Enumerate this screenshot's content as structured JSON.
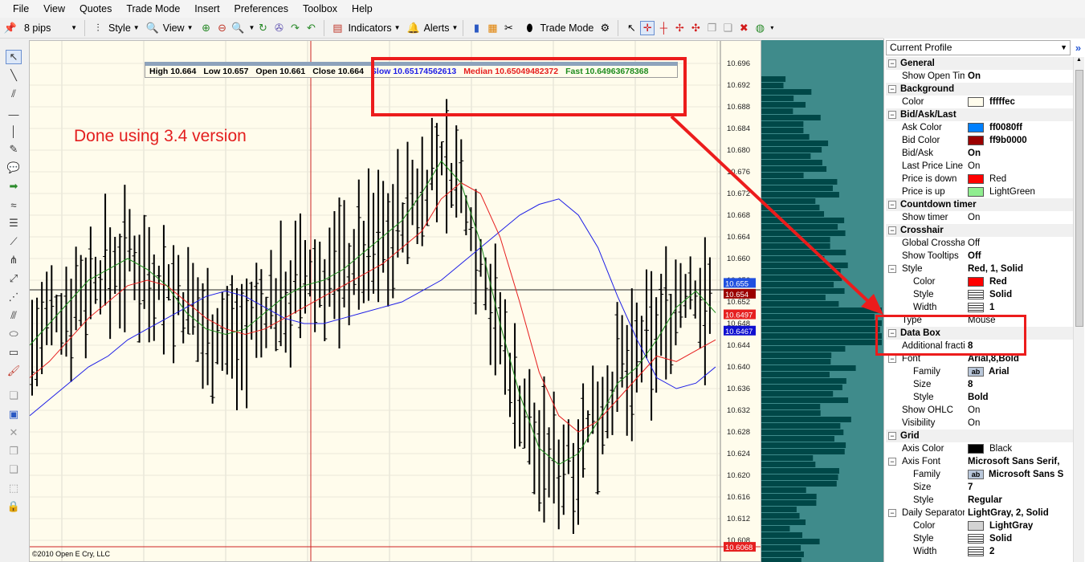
{
  "menu": [
    "File",
    "View",
    "Quotes",
    "Trade Mode",
    "Insert",
    "Preferences",
    "Toolbox",
    "Help"
  ],
  "toolbar": {
    "pips": "8 pips",
    "style_label": "Style",
    "view_label": "View",
    "indicators_label": "Indicators",
    "alerts_label": "Alerts",
    "trade_mode_label": "Trade Mode"
  },
  "datatip": {
    "high": "High 10.664",
    "low": "Low 10.657",
    "open": "Open 10.661",
    "close": "Close 10.664",
    "slow": "Slow 10.65174562613",
    "median": "Median 10.65049482372",
    "fast": "Fast 10.64963678368"
  },
  "annotation": "Done using 3.4 version",
  "copyright": "©2010 Open E Cry, LLC",
  "price_labels": {
    "top": "10.655",
    "mid": "10.654",
    "median": "10.6497",
    "slow": "10.6467",
    "bottom": "10.6068"
  },
  "colors": {
    "slow": "#1e1ee6",
    "median": "#e61e1e",
    "fast": "#1e8c1e",
    "chart_bg": "#fffcec",
    "crosshair": "#cc2222",
    "volume_bg": "#3f8b8b",
    "volume_bar": "#004848",
    "annotation": "#ec1c1c"
  },
  "chart_data": {
    "type": "line",
    "ylim": [
      10.606,
      10.698
    ],
    "y_ticks": [
      "10.696",
      "10.692",
      "10.688",
      "10.684",
      "10.680",
      "10.676",
      "10.672",
      "10.668",
      "10.664",
      "10.660",
      "10.656",
      "10.652",
      "10.648",
      "10.644",
      "10.640",
      "10.636",
      "10.632",
      "10.628",
      "10.624",
      "10.620",
      "10.616",
      "10.612",
      "10.608"
    ],
    "series": [
      {
        "name": "Slow",
        "values": [
          10.631,
          10.634,
          10.637,
          10.64,
          10.642,
          10.645,
          10.647,
          10.649,
          10.651,
          10.653,
          10.654,
          10.653,
          10.651,
          10.649,
          10.648,
          10.648,
          10.649,
          10.65,
          10.651,
          10.652,
          10.654,
          10.656,
          10.659,
          10.662,
          10.665,
          10.668,
          10.67,
          10.671,
          10.668,
          10.662,
          10.653,
          10.645,
          10.638,
          10.636,
          10.637,
          10.64
        ]
      },
      {
        "name": "Median",
        "values": [
          10.638,
          10.641,
          10.645,
          10.649,
          10.652,
          10.655,
          10.656,
          10.655,
          10.652,
          10.649,
          10.647,
          10.646,
          10.647,
          10.649,
          10.651,
          10.653,
          10.655,
          10.657,
          10.659,
          10.662,
          10.665,
          10.671,
          10.674,
          10.672,
          10.664,
          10.652,
          10.639,
          10.631,
          10.628,
          10.63,
          10.634,
          10.638,
          10.642,
          10.641,
          10.643,
          10.645
        ]
      },
      {
        "name": "Fast",
        "values": [
          10.644,
          10.648,
          10.652,
          10.656,
          10.658,
          10.66,
          10.658,
          10.655,
          10.65,
          10.647,
          10.646,
          10.647,
          10.65,
          10.653,
          10.655,
          10.656,
          10.658,
          10.661,
          10.664,
          10.667,
          10.672,
          10.678,
          10.674,
          10.663,
          10.648,
          10.635,
          10.625,
          10.622,
          10.624,
          10.63,
          10.637,
          10.64,
          10.645,
          10.651,
          10.654,
          10.65
        ]
      }
    ]
  },
  "profile": {
    "title": "Current Profile",
    "rows": [
      {
        "type": "cat",
        "label": "General",
        "exp": "−"
      },
      {
        "type": "prop",
        "label": "Show Open Times",
        "value": "On",
        "bold": true
      },
      {
        "type": "cat",
        "label": "Background",
        "exp": "−"
      },
      {
        "type": "prop",
        "label": "Color",
        "value": "fffffec",
        "swatch": "#fffcec",
        "bold": true
      },
      {
        "type": "cat",
        "label": "Bid/Ask/Last",
        "exp": "−"
      },
      {
        "type": "prop",
        "label": "Ask Color",
        "value": "ff0080ff",
        "swatch": "#0080ff",
        "bold": true
      },
      {
        "type": "prop",
        "label": "Bid Color",
        "value": "ff9b0000",
        "swatch": "#9b0000",
        "bold": true
      },
      {
        "type": "prop",
        "label": "Bid/Ask",
        "value": "On",
        "bold": true
      },
      {
        "type": "prop",
        "label": "Last Price Line",
        "value": "On"
      },
      {
        "type": "prop",
        "label": "Price is down",
        "value": "Red",
        "swatch": "#ff0000"
      },
      {
        "type": "prop",
        "label": "Price is up",
        "value": "LightGreen",
        "swatch": "#90ee90"
      },
      {
        "type": "cat",
        "label": "Countdown timer",
        "exp": "−"
      },
      {
        "type": "prop",
        "label": "Show timer",
        "value": "On"
      },
      {
        "type": "cat",
        "label": "Crosshair",
        "exp": "−"
      },
      {
        "type": "prop",
        "label": "Global Crosshair",
        "value": "Off"
      },
      {
        "type": "prop",
        "label": "Show Tooltips",
        "value": "Off",
        "bold": true
      },
      {
        "type": "group",
        "label": "Style",
        "value": "Red, 1, Solid",
        "bold": true,
        "exp": "−"
      },
      {
        "type": "sub",
        "label": "Color",
        "value": "Red",
        "swatch": "#ff0000",
        "bold": true
      },
      {
        "type": "sub",
        "label": "Style",
        "value": "Solid",
        "lines": true,
        "bold": true
      },
      {
        "type": "sub",
        "label": "Width",
        "value": "1",
        "lines": true,
        "bold": true
      },
      {
        "type": "prop",
        "label": "Type",
        "value": "Mouse"
      },
      {
        "type": "cat",
        "label": "Data Box",
        "exp": "−"
      },
      {
        "type": "prop",
        "label": "Additional fractional",
        "value": "8",
        "bold": true
      },
      {
        "type": "group",
        "label": "Font",
        "value": "Arial,8,Bold",
        "bold": true,
        "exp": "−"
      },
      {
        "type": "sub",
        "label": "Family",
        "value": "Arial",
        "ab": true,
        "bold": true
      },
      {
        "type": "sub",
        "label": "Size",
        "value": "8",
        "bold": true
      },
      {
        "type": "sub",
        "label": "Style",
        "value": "Bold",
        "bold": true
      },
      {
        "type": "prop",
        "label": "Show OHLC",
        "value": "On"
      },
      {
        "type": "prop",
        "label": "Visibility",
        "value": "On"
      },
      {
        "type": "cat",
        "label": "Grid",
        "exp": "−"
      },
      {
        "type": "prop",
        "label": "Axis Color",
        "value": "Black",
        "swatch": "#000000"
      },
      {
        "type": "group",
        "label": "Axis Font",
        "value": "Microsoft Sans Serif,",
        "bold": true,
        "exp": "−"
      },
      {
        "type": "sub",
        "label": "Family",
        "value": "Microsoft Sans S",
        "ab": true,
        "bold": true
      },
      {
        "type": "sub",
        "label": "Size",
        "value": "7",
        "bold": true
      },
      {
        "type": "sub",
        "label": "Style",
        "value": "Regular",
        "bold": true
      },
      {
        "type": "group",
        "label": "Daily Separator",
        "value": "LightGray, 2, Solid",
        "bold": true,
        "exp": "−"
      },
      {
        "type": "sub",
        "label": "Color",
        "value": "LightGray",
        "swatch": "#d3d3d3",
        "bold": true
      },
      {
        "type": "sub",
        "label": "Style",
        "value": "Solid",
        "lines": true,
        "bold": true
      },
      {
        "type": "sub",
        "label": "Width",
        "value": "2",
        "lines": true,
        "bold": true
      }
    ]
  }
}
